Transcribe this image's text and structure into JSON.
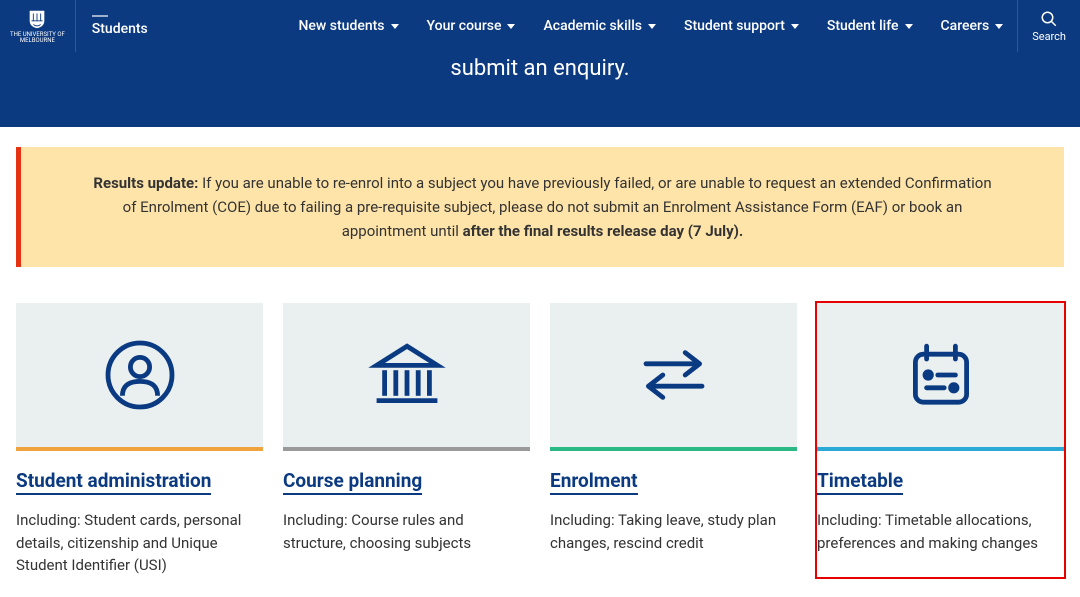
{
  "header": {
    "logo_text": "THE UNIVERSITY OF\nMELBOURNE",
    "students_label": "Students",
    "nav": [
      {
        "label": "New students"
      },
      {
        "label": "Your course"
      },
      {
        "label": "Academic skills"
      },
      {
        "label": "Student support"
      },
      {
        "label": "Student life"
      },
      {
        "label": "Careers"
      }
    ],
    "search_label": "Search"
  },
  "hero": {
    "text": "submit an enquiry."
  },
  "alert": {
    "lead": "Results update:",
    "body": " If you are unable to re-enrol into a subject you have previously failed, or are unable to request an extended Confirmation of Enrolment (COE) due to failing a pre-requisite subject, please do not submit an Enrolment Assistance Form (EAF) or book an appointment until ",
    "tail": "after the final results release day (7 July)."
  },
  "cards": [
    {
      "icon": "person-icon",
      "title": "Student administration",
      "desc": "Including: Student cards, personal details, citizenship and Unique Student Identifier (USI)"
    },
    {
      "icon": "bank-icon",
      "title": "Course planning",
      "desc": "Including: Course rules and structure, choosing subjects"
    },
    {
      "icon": "arrows-icon",
      "title": "Enrolment",
      "desc": "Including: Taking leave, study plan changes, rescind credit"
    },
    {
      "icon": "calendar-icon",
      "title": "Timetable",
      "desc": "Including: Timetable allocations, preferences and making changes"
    }
  ]
}
